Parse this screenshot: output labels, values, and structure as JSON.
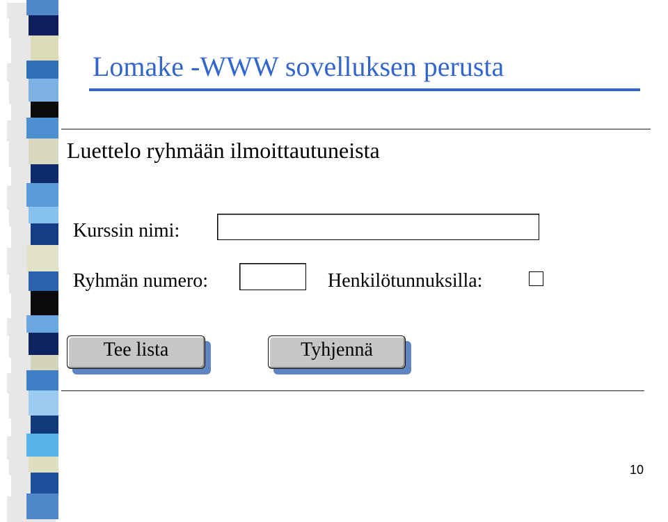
{
  "slide": {
    "title": "Lomake -WWW sovelluksen perusta",
    "page_number": "10"
  },
  "form": {
    "heading": "Luettelo ryhmään ilmoittautuneista",
    "course_name_label": "Kurssin nimi:",
    "course_name_value": "",
    "group_number_label": "Ryhmän numero:",
    "group_number_value": "",
    "ssn_label": "Henkilötunnuksilla:",
    "ssn_checked": false,
    "buttons": {
      "submit_label": "Tee lista",
      "reset_label": "Tyhjennä"
    }
  },
  "colors": {
    "title": "#3366cc",
    "button_face": "#c6c6c6",
    "button_shadow": "#5f86c2"
  }
}
